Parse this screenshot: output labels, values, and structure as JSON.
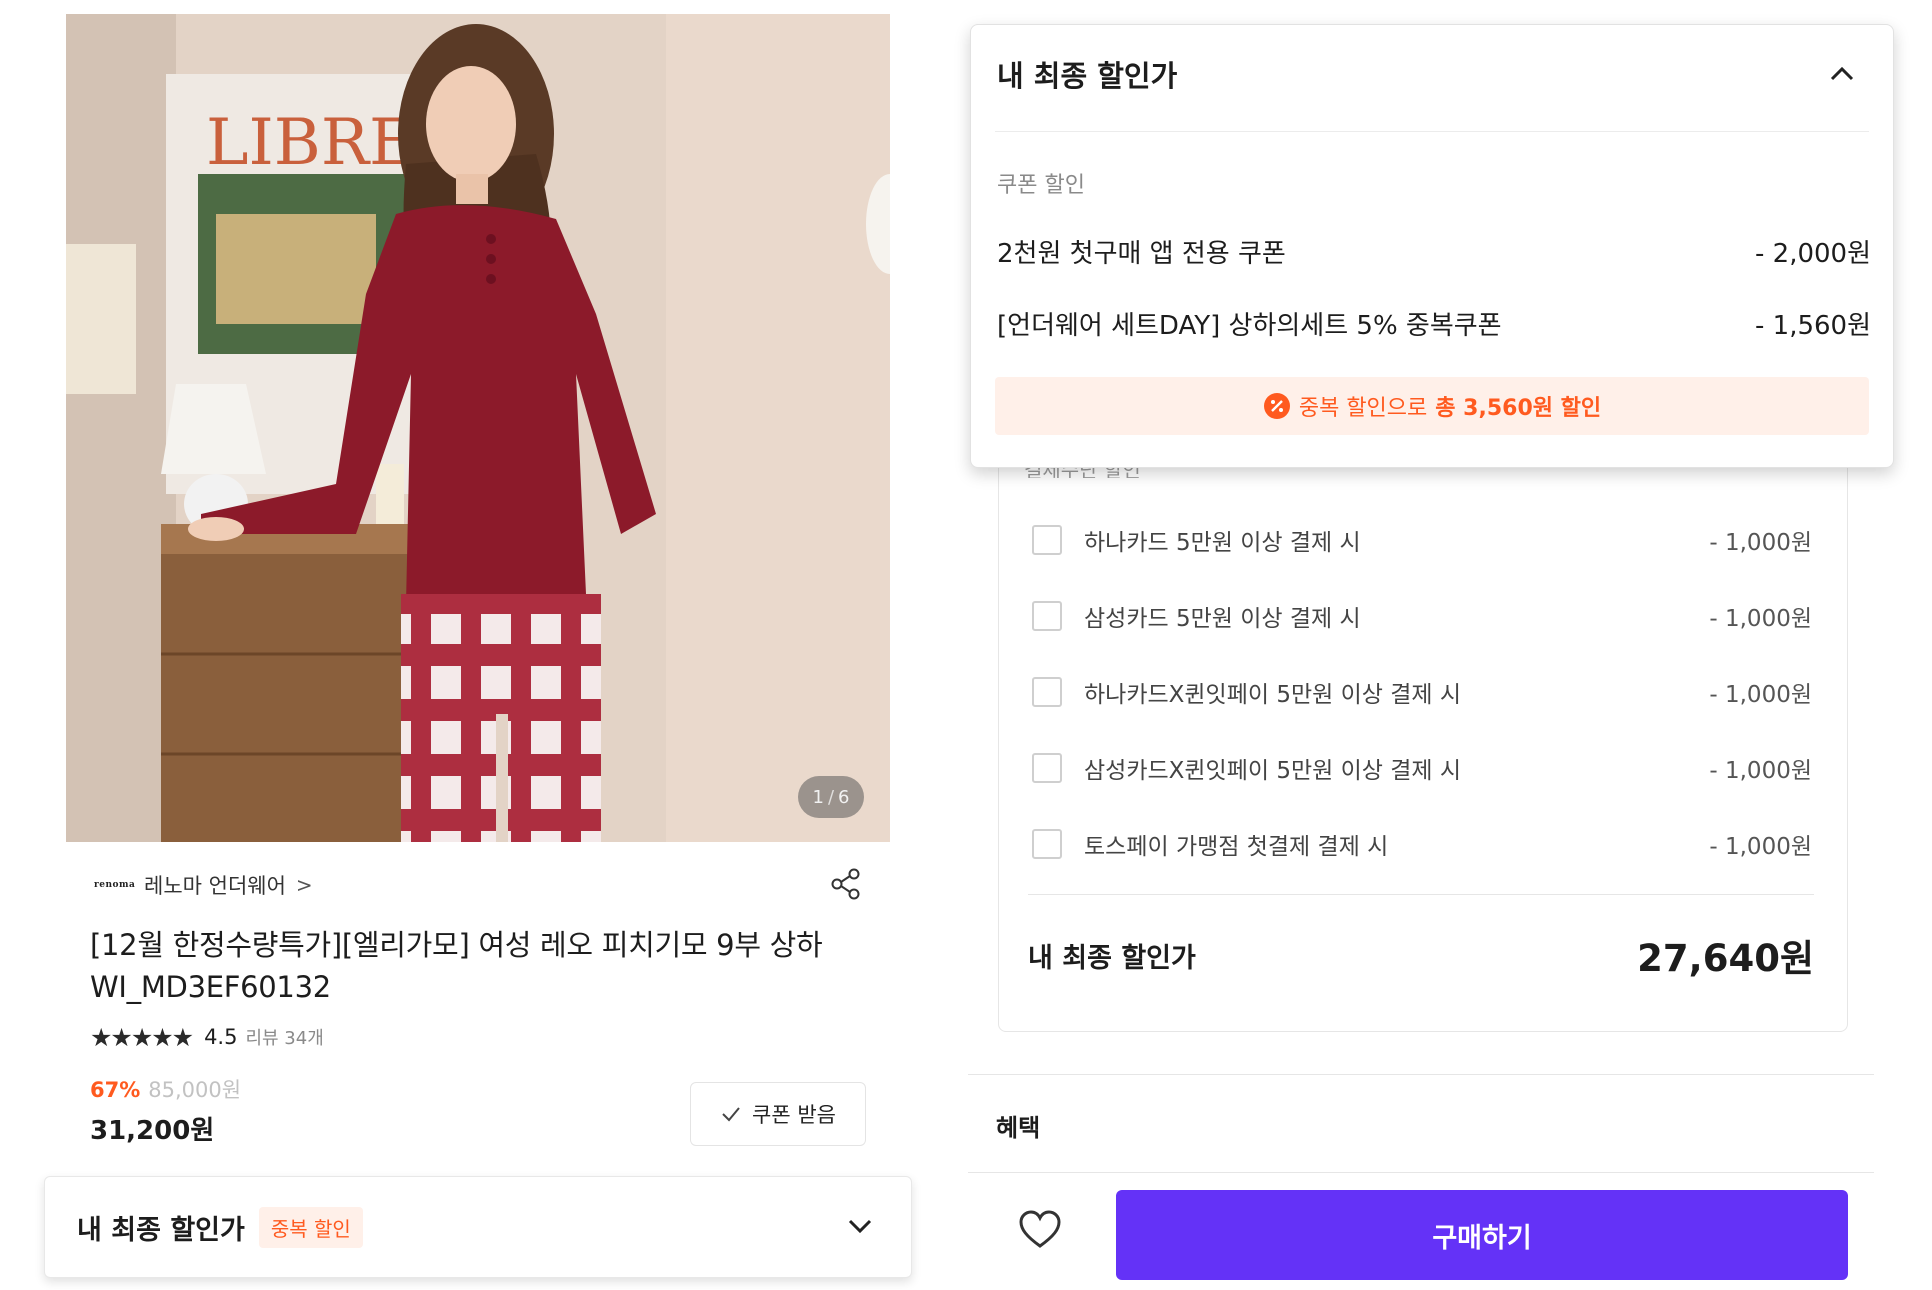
{
  "product": {
    "image_counter_current": "1",
    "image_counter_separator": "/",
    "image_counter_total": "6",
    "image_poster_text": "LIBRE",
    "brand_logo_text": "renoma",
    "brand_name": "레노마 언더웨어",
    "brand_chevron": ">",
    "title_line1": "[12월 한정수량특가][엘리가모] 여성 레오 피치기모 9부 상하",
    "title_line2": "WI_MD3EF60132",
    "rating_stars": "★★★★★",
    "rating_value": "4.5",
    "review_count": "리뷰 34개",
    "discount_rate": "67%",
    "original_price": "85,000원",
    "sale_price": "31,200원",
    "coupon_button_label": "쿠폰 받음"
  },
  "final_bar": {
    "label": "내 최종 할인가",
    "badge": "중복 할인"
  },
  "coupon_popup": {
    "title": "내 최종 할인가",
    "section_label": "쿠폰 할인",
    "coupons": [
      {
        "name": "2천원 첫구매 앱 전용 쿠폰",
        "amount": "- 2,000원"
      },
      {
        "name": "[언더웨어 세트DAY] 상하의세트 5% 중복쿠폰",
        "amount": "- 1,560원"
      }
    ],
    "total_prefix": "중복 할인으로",
    "total_amount": "총 3,560원 할인"
  },
  "payment": {
    "section_label_partial": "결제수단 할인",
    "items": [
      {
        "name": "하나카드 5만원 이상 결제 시",
        "amount": "- 1,000원"
      },
      {
        "name": "삼성카드 5만원 이상 결제 시",
        "amount": "- 1,000원"
      },
      {
        "name": "하나카드X퀸잇페이 5만원 이상 결제 시",
        "amount": "- 1,000원"
      },
      {
        "name": "삼성카드X퀸잇페이 5만원 이상 결제 시",
        "amount": "- 1,000원"
      },
      {
        "name": "토스페이 가맹점 첫결제 결제 시",
        "amount": "- 1,000원"
      }
    ],
    "final_label": "내 최종 할인가",
    "final_price": "27,640원"
  },
  "benefit_label": "혜택",
  "buy_button_label": "구매하기",
  "colors": {
    "accent_orange": "#ff5a1f",
    "buy_purple": "#6432f7",
    "badge_bg": "#fff0e9"
  },
  "icons": [
    "share-icon",
    "check-icon",
    "chevron-down-icon",
    "chevron-up-icon",
    "percent-icon",
    "heart-icon",
    "checkbox-icon"
  ]
}
